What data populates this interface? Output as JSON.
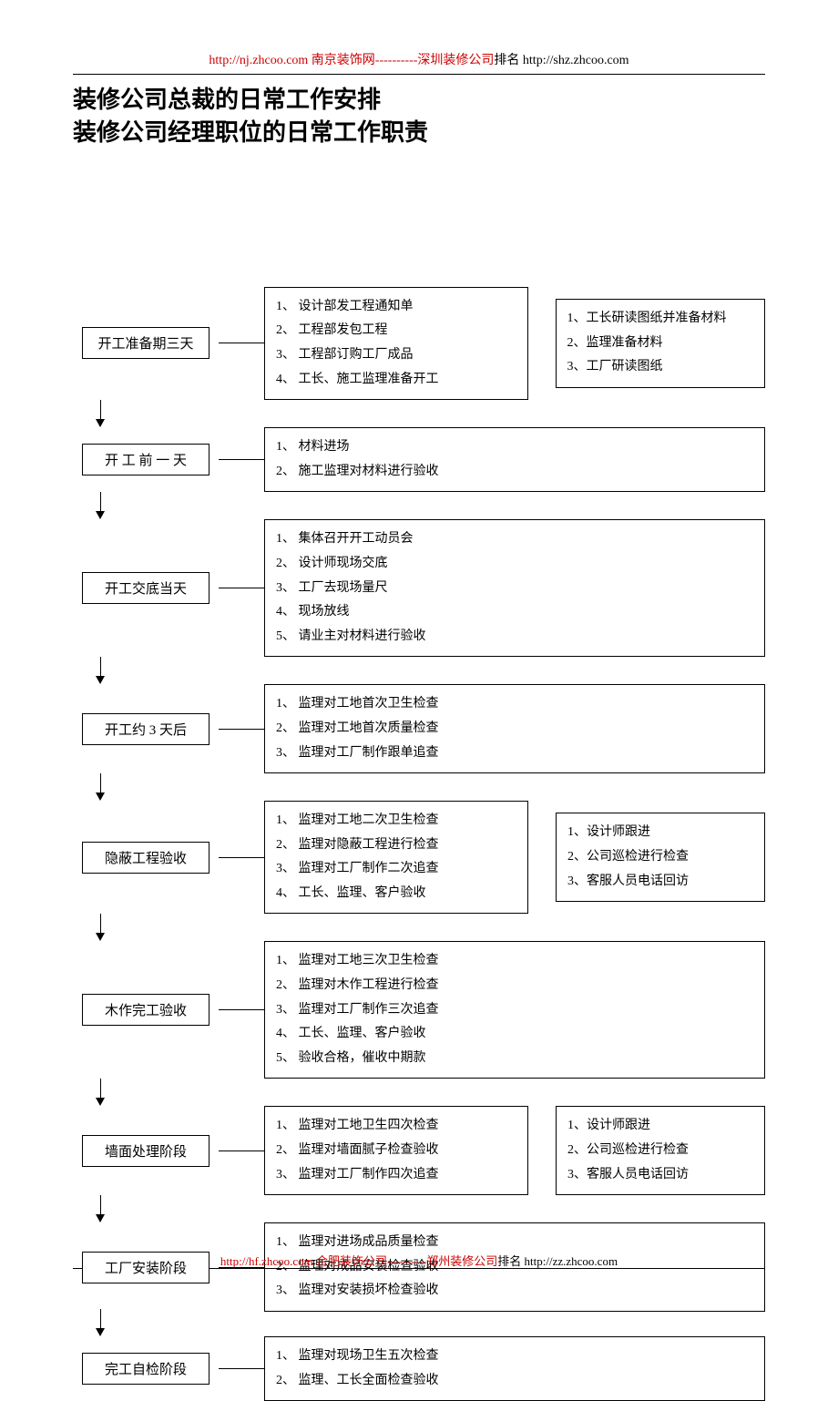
{
  "header": {
    "url1": "http://nj.zhcoo.com",
    "site1": "南京装饰网",
    "dash": "----------",
    "site2": "深圳装修公司",
    "rank": "排名",
    "url2": "http://shz.zhcoo.com"
  },
  "title": {
    "line1": "装修公司总裁的日常工作安排",
    "line2": "装修公司经理职位的日常工作职责"
  },
  "stages": [
    {
      "name": "开工准备期三天",
      "details": [
        "1、 设计部发工程通知单",
        "2、 工程部发包工程",
        "3、 工程部订购工厂成品",
        "4、 工长、施工监理准备开工"
      ],
      "side": [
        "1、工长研读图纸并准备材料",
        "2、监理准备材料",
        "3、工厂研读图纸"
      ]
    },
    {
      "name": "开 工 前 一 天",
      "details": [
        "1、 材料进场",
        "2、 施工监理对材料进行验收"
      ]
    },
    {
      "name": "开工交底当天",
      "details": [
        "1、 集体召开开工动员会",
        "2、 设计师现场交底",
        "3、 工厂去现场量尺",
        "4、 现场放线",
        "5、 请业主对材料进行验收"
      ]
    },
    {
      "name": "开工约 3 天后",
      "details": [
        "1、 监理对工地首次卫生检查",
        "2、 监理对工地首次质量检查",
        "3、 监理对工厂制作跟单追查"
      ]
    },
    {
      "name": "隐蔽工程验收",
      "details": [
        "1、 监理对工地二次卫生检查",
        "2、 监理对隐蔽工程进行检查",
        "3、 监理对工厂制作二次追查",
        "4、 工长、监理、客户验收"
      ],
      "side": [
        "1、设计师跟进",
        "2、公司巡检进行检查",
        "3、客服人员电话回访"
      ]
    },
    {
      "name": "木作完工验收",
      "details": [
        "1、 监理对工地三次卫生检查",
        "2、 监理对木作工程进行检查",
        "3、 监理对工厂制作三次追查",
        "4、 工长、监理、客户验收",
        "5、 验收合格，催收中期款"
      ]
    },
    {
      "name": "墙面处理阶段",
      "details": [
        "1、 监理对工地卫生四次检查",
        "2、 监理对墙面腻子检查验收",
        "3、 监理对工厂制作四次追查"
      ],
      "side": [
        "1、设计师跟进",
        "2、公司巡检进行检查",
        "3、客服人员电话回访"
      ]
    },
    {
      "name": "工厂安装阶段",
      "details": [
        "1、 监理对进场成品质量检查",
        "2、 监理对成品安装检查验收",
        "3、 监理对安装损坏检查验收"
      ]
    },
    {
      "name": "完工自检阶段",
      "details": [
        "1、 监理对现场卫生五次检查",
        "2、 监理、工长全面检查验收"
      ]
    }
  ],
  "footer": {
    "url1": "http://hf.zhcoo.com",
    "site1": "合肥装饰公司",
    "dash": "----------",
    "site2": "郑州装修公司",
    "rank": "排名",
    "url2": "http://zz.zhcoo.com"
  }
}
